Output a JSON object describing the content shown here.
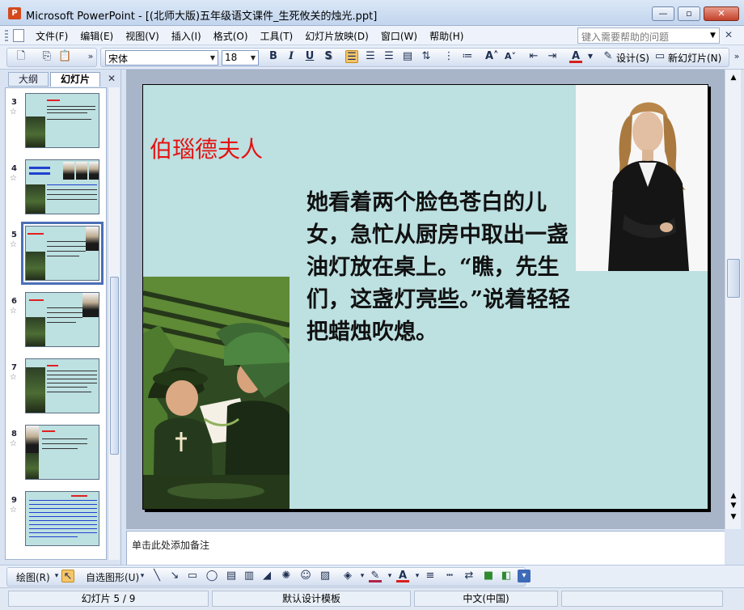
{
  "window": {
    "app_icon_letter": "P",
    "title": "Microsoft PowerPoint - [(北师大版)五年级语文课件_生死攸关的烛光.ppt]",
    "minimize": "—",
    "maximize": "▫",
    "close": "✕"
  },
  "menu": {
    "items": [
      "文件(F)",
      "编辑(E)",
      "视图(V)",
      "插入(I)",
      "格式(O)",
      "工具(T)",
      "幻灯片放映(D)",
      "窗口(W)",
      "帮助(H)"
    ],
    "help_placeholder": "键入需要帮助的问题",
    "close_doc": "✕"
  },
  "toolbar": {
    "font": "宋体",
    "size": "18",
    "bold": "B",
    "italic": "I",
    "underline": "U",
    "shadow": "S",
    "design_label": "设计(S)",
    "new_slide_label": "新幻灯片(N)"
  },
  "left_panel": {
    "tab_outline": "大纲",
    "tab_slides": "幻灯片",
    "close": "✕",
    "star": "☆",
    "slide_numbers": [
      "3",
      "4",
      "5",
      "6",
      "7",
      "8",
      "9"
    ],
    "selected_slide": "5"
  },
  "slide": {
    "title": "伯瑙德夫人",
    "body": "她看着两个脸色苍白的儿女，急忙从厨房中取出一盏油灯放在桌上。“瞧，先生们，这盏灯亮些。”说着轻轻把蜡烛吹熄。",
    "background_color": "#bde0e1",
    "title_color": "#e51212"
  },
  "notes": {
    "placeholder": "单击此处添加备注"
  },
  "drawbar": {
    "draw_label": "绘图(R)",
    "autoshapes_label": "自选图形(U)"
  },
  "status": {
    "slide_counter": "幻灯片 5 / 9",
    "template": "默认设计模板",
    "language": "中文(中国)"
  }
}
